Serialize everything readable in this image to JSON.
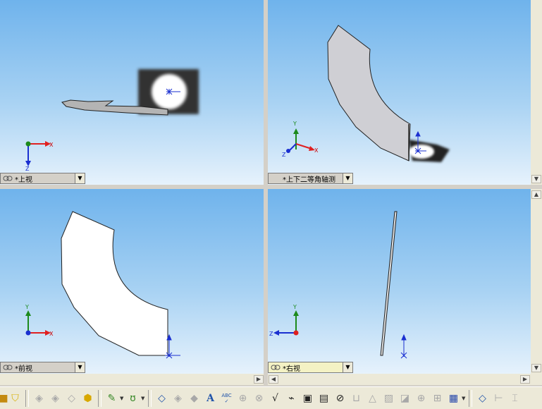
{
  "viewports": {
    "top_left": {
      "label": "*上视",
      "axes": {
        "x": "X",
        "z": "Z"
      }
    },
    "top_right": {
      "label": "*上下二等角轴测",
      "axes": {
        "x": "X",
        "y": "Y",
        "z": "Z"
      }
    },
    "bottom_left": {
      "label": "*前视",
      "axes": {
        "x": "X",
        "y": "Y"
      }
    },
    "bottom_right": {
      "label": "*右视",
      "axes": {
        "y": "Y",
        "z": "Z"
      }
    }
  },
  "toolbar": {
    "text_tool_label": "A",
    "spell_label": "ABC",
    "items": [
      "box-icon",
      "shirt-icon",
      "sheet-metal-icon",
      "sheet-metal-2-icon",
      "sheet-metal-3-icon",
      "cube-icon",
      "smart-tool-icon",
      "curve-icon",
      "smart-dimension-icon",
      "note-icon",
      "balloon-icon",
      "text-icon",
      "spell-check-icon",
      "zoom-icon",
      "magnify-icon",
      "surface-finish-icon",
      "weld-icon",
      "datum-icon",
      "geometric-tolerance-icon",
      "datum-target-icon",
      "hole-callout-icon",
      "center-mark-icon",
      "hatch-icon",
      "block-icon",
      "centerline-icon",
      "dowel-icon",
      "table-icon",
      "bom-icon",
      "revision-icon",
      "dimension-icon"
    ]
  },
  "colors": {
    "accent_active": "#f4f2c4",
    "axis_x": "#e02020",
    "axis_y": "#1c8a1c",
    "axis_z": "#1a2fd0"
  }
}
